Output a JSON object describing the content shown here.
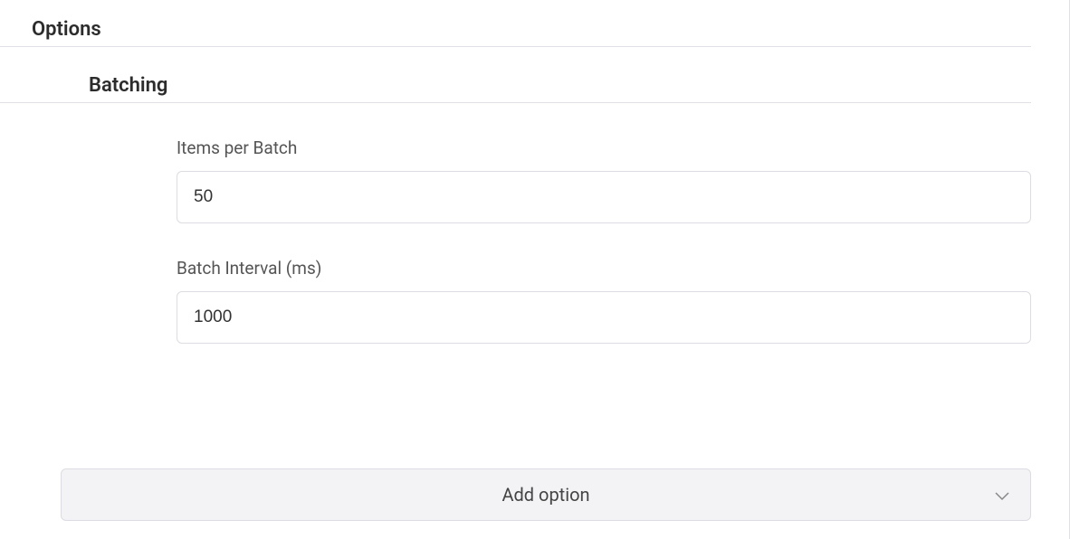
{
  "options": {
    "header": "Options",
    "batching": {
      "header": "Batching",
      "fields": {
        "items_per_batch": {
          "label": "Items per Batch",
          "value": "50"
        },
        "batch_interval": {
          "label": "Batch Interval (ms)",
          "value": "1000"
        }
      }
    }
  },
  "add_option_button": {
    "label": "Add option"
  }
}
